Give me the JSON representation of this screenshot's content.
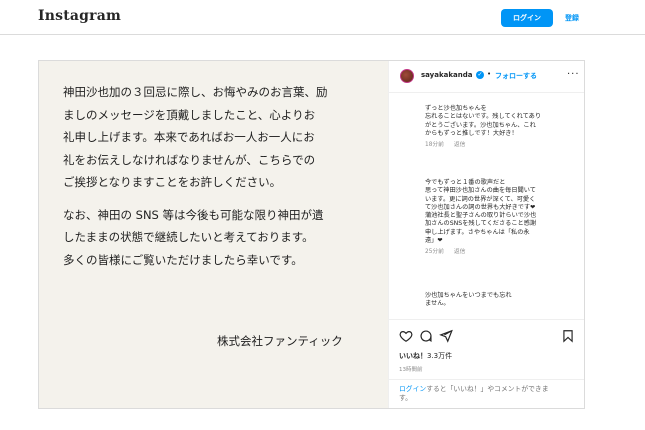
{
  "nav": {
    "logo": "Instagram",
    "login_label": "ログイン",
    "signup_label": "登録"
  },
  "media": {
    "paragraph1": "神田沙也加の３回忌に際し、お悔やみのお言葉、励\nましのメッセージを頂戴しましたこと、心よりお\n礼申し上げます。本来であればお一人お一人にお\n礼をお伝えしなければなりませんが、こちらでの\nご挨拶となりますことをお許しください。",
    "paragraph2": "なお、神田の SNS 等は今後も可能な限り神田が遺\nしたままの状態で継続したいと考えております。\n多くの皆様にご覧いただけましたら幸いです。",
    "signature": "株式会社ファンティック"
  },
  "header": {
    "username": "sayakakanda",
    "separator": "•",
    "follow_label": "フォローする",
    "more": "···"
  },
  "comments": [
    {
      "text": "ずっと沙也加ちゃんを\n忘れることはないです。残してくれてあり\nがとうございます。沙也加ちゃん、これ\nからもずっと推しです！大好き！",
      "time": "18分前",
      "reply": "返信"
    },
    {
      "text": "今でもずっと１番の歌声だと\n思って神田沙也加さんの曲を毎日聞いて\nいます。更に詞の世界が深くて、可愛く\nて沙也加さんの詞の世界も大好きです❤\n蒲池社長と聖子さんの取り計らいで沙也\n加さんのSNSを残してくださること感謝\n申し上げます。さやちゃんは「私の永\n遠」❤",
      "time": "25分前",
      "reply": "返信"
    },
    {
      "text": "沙也加ちゃんをいつまでも忘れ\nません。",
      "time": "",
      "reply": ""
    }
  ],
  "actions": {
    "likes_label": "いいね！",
    "likes_count": "3.3万件",
    "time_ago": "13時間前"
  },
  "login_bar": {
    "link": "ログイン",
    "text": "すると「いいね！」やコメントができま\nす。"
  }
}
